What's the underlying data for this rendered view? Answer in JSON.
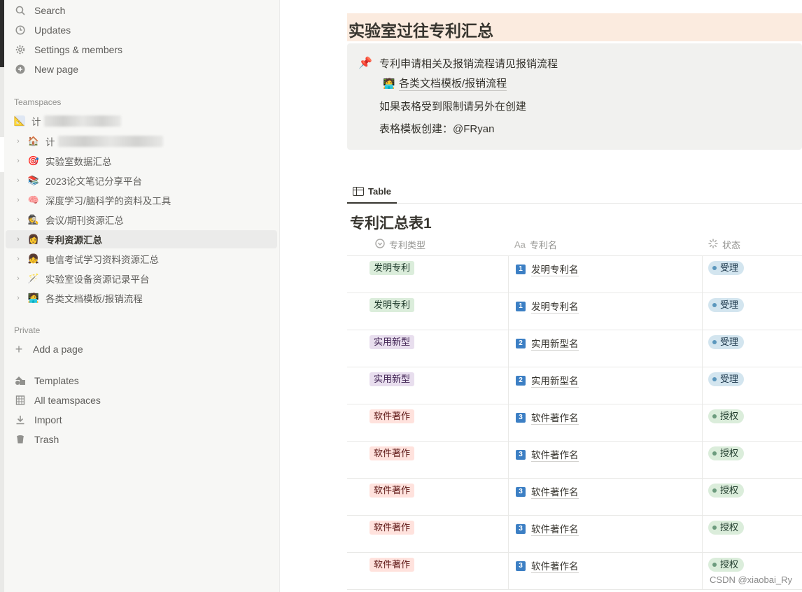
{
  "sidebar": {
    "top_items": [
      {
        "label": "Search",
        "icon": "search-icon"
      },
      {
        "label": "Updates",
        "icon": "clock-icon"
      },
      {
        "label": "Settings & members",
        "icon": "gear-icon"
      },
      {
        "label": "New page",
        "icon": "plus-circle-icon"
      }
    ],
    "teamspaces_label": "Teamspaces",
    "teamspace_items": [
      {
        "label": "计",
        "emoji": "📐",
        "blurred": true
      },
      {
        "label": "计",
        "emoji": "🏠",
        "blurred": true
      },
      {
        "label": "实验室数据汇总",
        "emoji": "🎯"
      },
      {
        "label": "2023论文笔记分享平台",
        "emoji": "📚"
      },
      {
        "label": "深度学习/脑科学的资料及工具",
        "emoji": "🧠"
      },
      {
        "label": "会议/期刊资源汇总",
        "emoji": "🕵"
      },
      {
        "label": "专利资源汇总",
        "emoji": "👩",
        "active": true
      },
      {
        "label": "电信考试学习资料资源汇总",
        "emoji": "👧"
      },
      {
        "label": "实验室设备资源记录平台",
        "emoji": "🪄"
      },
      {
        "label": "各类文档模板/报销流程",
        "emoji": "🧑‍💻"
      }
    ],
    "private_label": "Private",
    "add_page_label": "Add a page",
    "bottom_items": [
      {
        "label": "Templates",
        "icon": "templates-icon"
      },
      {
        "label": "All teamspaces",
        "icon": "building-icon"
      },
      {
        "label": "Import",
        "icon": "import-icon"
      },
      {
        "label": "Trash",
        "icon": "trash-icon"
      }
    ]
  },
  "page": {
    "title": "实验室过往专利汇总",
    "callout": {
      "icon": "📌",
      "line1": "专利申请相关及报销流程请见报销流程",
      "link_emoji": "🧑‍💻",
      "link_label": "各类文档模板/报销流程",
      "line3": "如果表格受到限制请另外在创建",
      "line4": "表格模板创建：@FRyan"
    },
    "view_tab": "Table",
    "table_title": "专利汇总表1",
    "columns": {
      "type": "专利类型",
      "name": "专利名",
      "status": "状态",
      "name_icon_text": "Aa"
    },
    "rows": [
      {
        "type": "发明专利",
        "type_color": "green",
        "num": "1",
        "name": "发明专利名",
        "status": "受理",
        "status_color": "blue"
      },
      {
        "type": "发明专利",
        "type_color": "green",
        "num": "1",
        "name": "发明专利名",
        "status": "受理",
        "status_color": "blue"
      },
      {
        "type": "实用新型",
        "type_color": "purple",
        "num": "2",
        "name": "实用新型名",
        "status": "受理",
        "status_color": "blue"
      },
      {
        "type": "实用新型",
        "type_color": "purple",
        "num": "2",
        "name": "实用新型名",
        "status": "受理",
        "status_color": "blue"
      },
      {
        "type": "软件著作",
        "type_color": "red",
        "num": "3",
        "name": "软件著作名",
        "status": "授权",
        "status_color": "green"
      },
      {
        "type": "软件著作",
        "type_color": "red",
        "num": "3",
        "name": "软件著作名",
        "status": "授权",
        "status_color": "green"
      },
      {
        "type": "软件著作",
        "type_color": "red",
        "num": "3",
        "name": "软件著作名",
        "status": "授权",
        "status_color": "green"
      },
      {
        "type": "软件著作",
        "type_color": "red",
        "num": "3",
        "name": "软件著作名",
        "status": "授权",
        "status_color": "green"
      },
      {
        "type": "软件著作",
        "type_color": "red",
        "num": "3",
        "name": "软件著作名",
        "status": "授权",
        "status_color": "green"
      }
    ]
  },
  "watermark": "CSDN @xiaobai_Ry"
}
